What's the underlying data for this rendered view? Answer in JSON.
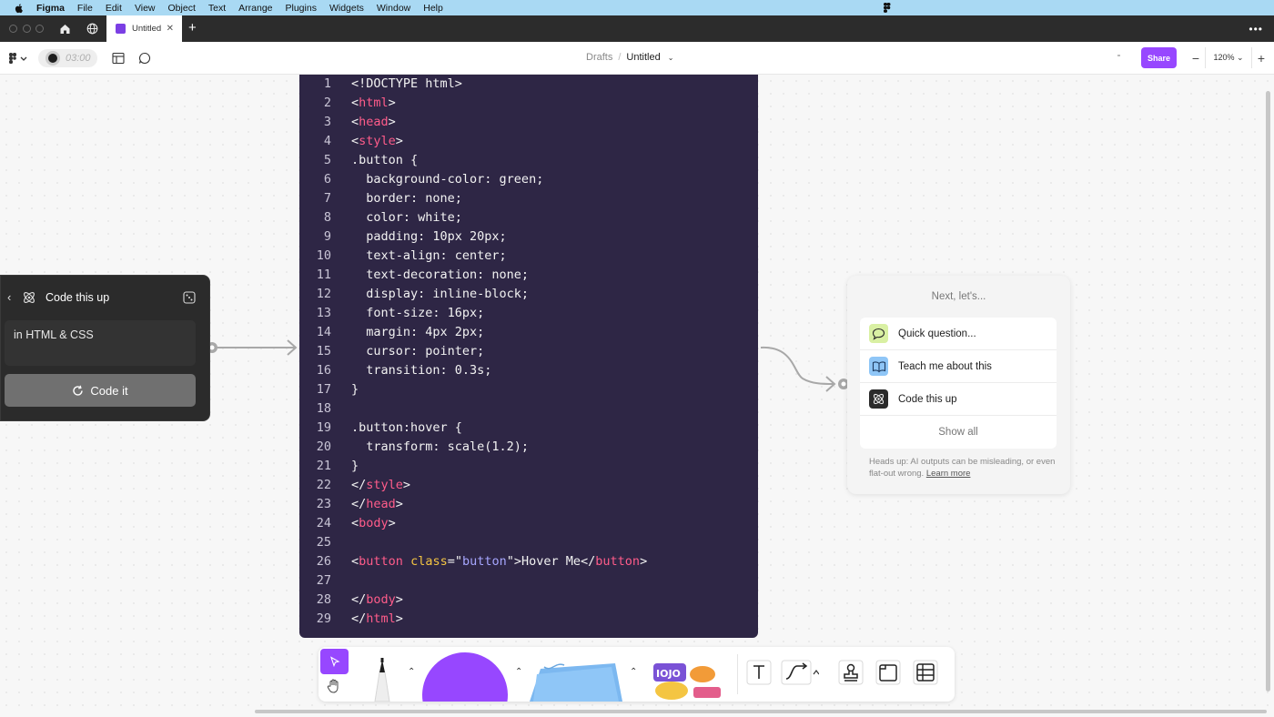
{
  "menubar": {
    "app": "Figma",
    "items": [
      "File",
      "Edit",
      "View",
      "Object",
      "Text",
      "Arrange",
      "Plugins",
      "Widgets",
      "Window",
      "Help"
    ]
  },
  "tabs": {
    "active_label": "Untitled"
  },
  "toolbar": {
    "timer": "03:00",
    "breadcrumb_parent": "Drafts",
    "breadcrumb_current": "Untitled",
    "share_label": "Share",
    "zoom": "120%"
  },
  "left_widget": {
    "title": "Code this up",
    "input_value": "in HTML & CSS",
    "button_label": "Code it"
  },
  "code": {
    "lines": [
      {
        "n": "1",
        "parts": [
          [
            "t",
            "<!DOCTYPE html>"
          ]
        ]
      },
      {
        "n": "2",
        "parts": [
          [
            "t",
            "<"
          ],
          [
            "tag",
            "html"
          ],
          [
            "t",
            ">"
          ]
        ]
      },
      {
        "n": "3",
        "parts": [
          [
            "t",
            "<"
          ],
          [
            "tag",
            "head"
          ],
          [
            "t",
            ">"
          ]
        ]
      },
      {
        "n": "4",
        "parts": [
          [
            "t",
            "<"
          ],
          [
            "tag",
            "style"
          ],
          [
            "t",
            ">"
          ]
        ]
      },
      {
        "n": "5",
        "parts": [
          [
            "t",
            ".button {"
          ]
        ]
      },
      {
        "n": "6",
        "parts": [
          [
            "t",
            "  background-color: green;"
          ]
        ]
      },
      {
        "n": "7",
        "parts": [
          [
            "t",
            "  border: none;"
          ]
        ]
      },
      {
        "n": "8",
        "parts": [
          [
            "t",
            "  color: white;"
          ]
        ]
      },
      {
        "n": "9",
        "parts": [
          [
            "t",
            "  padding: 10px 20px;"
          ]
        ]
      },
      {
        "n": "10",
        "parts": [
          [
            "t",
            "  text-align: center;"
          ]
        ]
      },
      {
        "n": "11",
        "parts": [
          [
            "t",
            "  text-decoration: none;"
          ]
        ]
      },
      {
        "n": "12",
        "parts": [
          [
            "t",
            "  display: inline-block;"
          ]
        ]
      },
      {
        "n": "13",
        "parts": [
          [
            "t",
            "  font-size: 16px;"
          ]
        ]
      },
      {
        "n": "14",
        "parts": [
          [
            "t",
            "  margin: 4px 2px;"
          ]
        ]
      },
      {
        "n": "15",
        "parts": [
          [
            "t",
            "  cursor: pointer;"
          ]
        ]
      },
      {
        "n": "16",
        "parts": [
          [
            "t",
            "  transition: 0.3s;"
          ]
        ]
      },
      {
        "n": "17",
        "parts": [
          [
            "t",
            "}"
          ]
        ]
      },
      {
        "n": "18",
        "parts": []
      },
      {
        "n": "19",
        "parts": [
          [
            "t",
            ".button:hover {"
          ]
        ]
      },
      {
        "n": "20",
        "parts": [
          [
            "t",
            "  transform: scale(1.2);"
          ]
        ]
      },
      {
        "n": "21",
        "parts": [
          [
            "t",
            "}"
          ]
        ]
      },
      {
        "n": "22",
        "parts": [
          [
            "t",
            "</"
          ],
          [
            "tag",
            "style"
          ],
          [
            "t",
            ">"
          ]
        ]
      },
      {
        "n": "23",
        "parts": [
          [
            "t",
            "</"
          ],
          [
            "tag",
            "head"
          ],
          [
            "t",
            ">"
          ]
        ]
      },
      {
        "n": "24",
        "parts": [
          [
            "t",
            "<"
          ],
          [
            "tag",
            "body"
          ],
          [
            "t",
            ">"
          ]
        ]
      },
      {
        "n": "25",
        "parts": []
      },
      {
        "n": "26",
        "parts": [
          [
            "t",
            "<"
          ],
          [
            "tag",
            "button"
          ],
          [
            "t",
            " "
          ],
          [
            "attr",
            "class"
          ],
          [
            "t",
            "=\""
          ],
          [
            "str",
            "button"
          ],
          [
            "t",
            "\">Hover Me</"
          ],
          [
            "tag",
            "button"
          ],
          [
            "t",
            ">"
          ]
        ]
      },
      {
        "n": "27",
        "parts": []
      },
      {
        "n": "28",
        "parts": [
          [
            "t",
            "</"
          ],
          [
            "tag",
            "body"
          ],
          [
            "t",
            ">"
          ]
        ]
      },
      {
        "n": "29",
        "parts": [
          [
            "t",
            "</"
          ],
          [
            "tag",
            "html"
          ],
          [
            "t",
            ">"
          ]
        ]
      }
    ]
  },
  "next_panel": {
    "title": "Next, let's...",
    "items": [
      {
        "label": "Quick question...",
        "icon": "speech-bubble-icon",
        "color": "#d9f0a3"
      },
      {
        "label": "Teach me about this",
        "icon": "open-book-icon",
        "color": "#8fc6f7"
      },
      {
        "label": "Code this up",
        "icon": "atom-icon",
        "color": "#2b2b2b"
      }
    ],
    "show_all": "Show all",
    "footer_text": "Heads up: AI outputs can be misleading, or even flat-out wrong.",
    "footer_link": "Learn more"
  },
  "colors": {
    "accent": "#9747ff",
    "code_bg": "#2e2645",
    "tag": "#ff5c8a",
    "attr": "#f4c542",
    "string": "#a6a6ff",
    "menubar": "#a9d9f3"
  },
  "bottom_tools": [
    "move-tool",
    "hand-tool",
    "marker-tool",
    "shape-tool",
    "sticky-note-tool",
    "stickers-tool",
    "text-tool",
    "connector-tool",
    "stamp-tool",
    "section-tool",
    "table-tool"
  ]
}
